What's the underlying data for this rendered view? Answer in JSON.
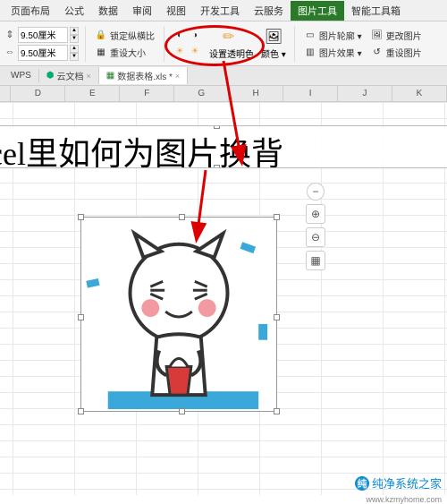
{
  "menu": {
    "items": [
      "页面布局",
      "公式",
      "数据",
      "审阅",
      "视图",
      "开发工具",
      "云服务",
      "图片工具",
      "智能工具箱"
    ],
    "active_index": 7
  },
  "ribbon": {
    "height": {
      "value": "9.50厘米"
    },
    "width": {
      "value": "9.50厘米"
    },
    "lock_ratio": "锁定纵横比",
    "reset_size": "重设大小",
    "set_transparent": "设置透明色",
    "color": "颜色",
    "outline": "图片轮廓",
    "effect": "图片效果",
    "change_pic": "更改图片",
    "reset_pic": "重设图片"
  },
  "tabs": {
    "wps_label": "WPS",
    "cloud_doc": "云文档",
    "file": "数据表格.xls *"
  },
  "columns": [
    "D",
    "E",
    "F",
    "G",
    "H",
    "I",
    "J",
    "K"
  ],
  "textbox_content": "xcel里如何为图片换背",
  "watermark": {
    "text": "纯净系统之家",
    "url": "www.kzmyhome.com"
  }
}
